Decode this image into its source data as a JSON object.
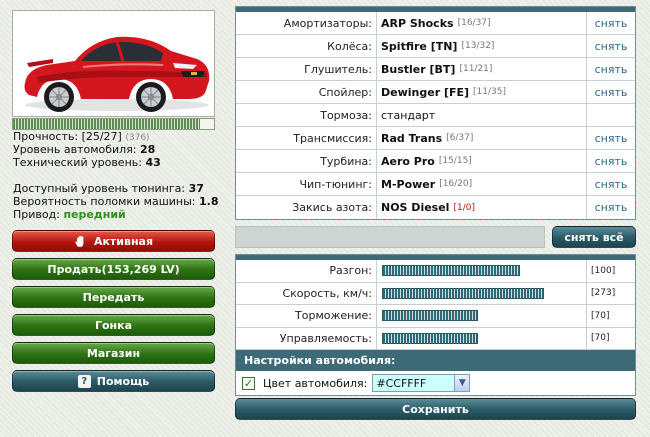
{
  "car": {
    "image_alt": "red-coupe",
    "durability_label": "Прочность:",
    "durability_value": "[25/27]",
    "durability_total": "(376)",
    "durability_fraction": 0.93,
    "car_level_label": "Уровень автомобиля:",
    "car_level": "28",
    "tech_level_label": "Технический уровень:",
    "tech_level": "43",
    "tuning_level_label": "Доступный уровень тюнинга:",
    "tuning_level": "37",
    "breakdown_label": "Вероятность поломки машины:",
    "breakdown": "1.8",
    "drive_label": "Привод:",
    "drive": "передний"
  },
  "actions": {
    "active": "Активная",
    "sell": "Продать(153,269 LV)",
    "transfer": "Передать",
    "race": "Гонка",
    "shop": "Магазин",
    "help": "Помощь"
  },
  "tuning": [
    {
      "label": "Амортизаторы:",
      "part": "ARP Shocks",
      "durability": "[16/37]",
      "action": "снять",
      "installed": true
    },
    {
      "label": "Колёса:",
      "part": "Spitfire [TN]",
      "durability": "[13/32]",
      "action": "снять",
      "installed": true
    },
    {
      "label": "Глушитель:",
      "part": "Bustler [BT]",
      "durability": "[11/21]",
      "action": "снять",
      "installed": true
    },
    {
      "label": "Спойлер:",
      "part": "Dewinger [FE]",
      "durability": "[11/35]",
      "action": "снять",
      "installed": true
    },
    {
      "label": "Тормоза:",
      "part": "стандарт",
      "durability": "",
      "action": "",
      "installed": false
    },
    {
      "label": "Трансмиссия:",
      "part": "Rad Trans",
      "durability": "[6/37]",
      "action": "снять",
      "installed": true
    },
    {
      "label": "Турбина:",
      "part": "Aero Pro",
      "durability": "[15/15]",
      "action": "снять",
      "installed": true
    },
    {
      "label": "Чип-тюнинг:",
      "part": "M-Power",
      "durability": "[16/20]",
      "action": "снять",
      "installed": true
    },
    {
      "label": "Закись азота:",
      "part": "NOS Diesel",
      "durability": "[1/0]",
      "action": "снять",
      "installed": true,
      "warning": true
    }
  ],
  "remove_all": "снять всё",
  "performance": [
    {
      "label": "Разгон:",
      "value": "[100]",
      "fraction": 0.69
    },
    {
      "label": "Скорость, км/ч:",
      "value": "[273]",
      "fraction": 0.81
    },
    {
      "label": "Торможение:",
      "value": "[70]",
      "fraction": 0.48
    },
    {
      "label": "Управляемость:",
      "value": "[70]",
      "fraction": 0.48
    }
  ],
  "settings": {
    "title": "Настройки автомобиля:",
    "color_label": "Цвет автомобиля:",
    "color_value": "#CCFFFF",
    "color_checked": true,
    "save": "Сохранить"
  }
}
